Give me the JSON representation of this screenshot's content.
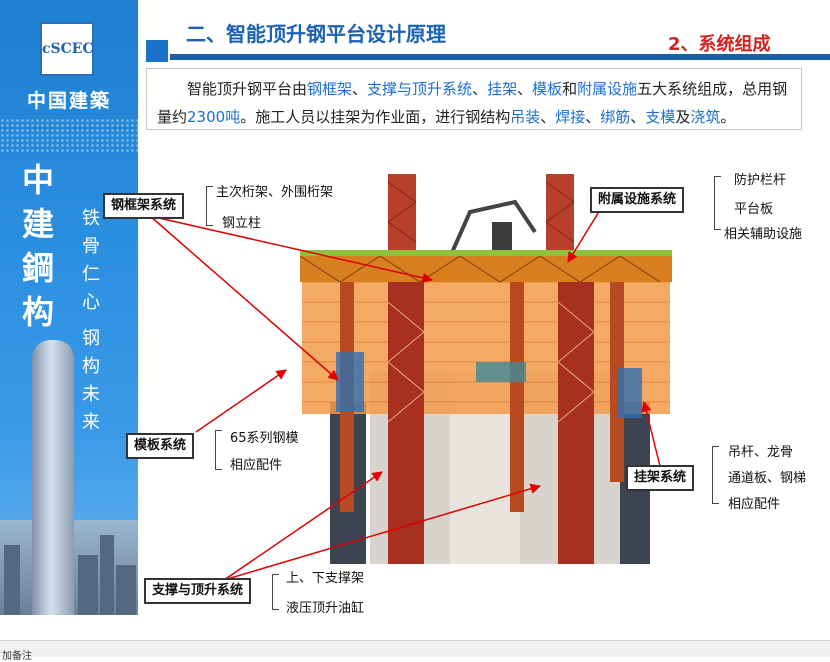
{
  "sidebar": {
    "logo_text": "cSCEC",
    "brand": "中国建築",
    "calligraphy": [
      "中",
      "建",
      "鋼",
      "构"
    ],
    "motto": [
      "铁",
      "骨",
      "仁",
      "心",
      "钢",
      "构",
      "未",
      "来"
    ]
  },
  "header": {
    "page_title": "二、智能顶升钢平台设计原理",
    "section_title": "2、系统组成"
  },
  "intro": {
    "t1": "智能顶升钢平台由",
    "h1": "钢框架",
    "t2": "、",
    "h2": "支撑与顶升系统",
    "t3": "、",
    "h3": "挂架",
    "t4": "、",
    "h4": "模板",
    "t5": "和",
    "h5": "附属设施",
    "t6": "五大系统组成，总用钢量约",
    "h6": "2300吨",
    "t7": "。施工人员以挂架为作业面，进行钢结构",
    "h7": "吊装",
    "t8": "、",
    "h8": "焊接",
    "t9": "、",
    "h9": "绑筋",
    "t10": "、",
    "h10": "支模",
    "t11": "及",
    "h11": "浇筑",
    "t12": "。"
  },
  "labels": {
    "frame": {
      "title": "钢框架系统",
      "items": [
        "主次桁架、外围桁架",
        "钢立柱"
      ]
    },
    "aux": {
      "title": "附属设施系统",
      "items": [
        "防护栏杆",
        "平台板",
        "相关辅助设施"
      ]
    },
    "formwork": {
      "title": "模板系统",
      "items": [
        "65系列钢模",
        "相应配件"
      ]
    },
    "hanger": {
      "title": "挂架系统",
      "items": [
        "吊杆、龙骨",
        "通道板、钢梯",
        "相应配件"
      ]
    },
    "support": {
      "title": "支撑与顶升系统",
      "items": [
        "上、下支撑架",
        "液压顶升油缸"
      ]
    }
  },
  "status": {
    "text": "加备注"
  },
  "colors": {
    "accent": "#1a62b4",
    "highlight": "#1a6fd0",
    "section": "#d62020",
    "arrow": "#e00000"
  }
}
